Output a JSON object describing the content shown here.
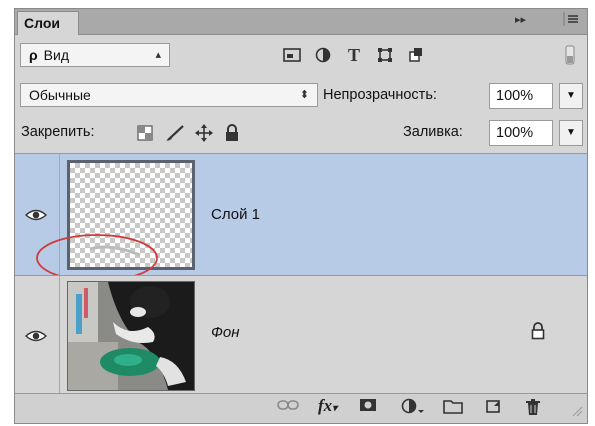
{
  "panel": {
    "tab_label": "Слои",
    "menu_glyphs": "▸▸",
    "menu_icon": "panel-menu-icon"
  },
  "filter": {
    "search_glyph": "ρ",
    "kind_label": "Вид",
    "icons": [
      "pixel-filter-icon",
      "adjustment-filter-icon",
      "type-filter-icon",
      "shape-filter-icon",
      "smart-object-filter-icon",
      "filter-toggle-icon"
    ]
  },
  "blend": {
    "mode": "Обычные",
    "opacity_label": "Непрозрачность:",
    "opacity_value": "100%"
  },
  "lock": {
    "label": "Закрепить:",
    "icons": [
      "lock-transparent-icon",
      "lock-paint-icon",
      "lock-move-icon",
      "lock-all-icon"
    ],
    "fill_label": "Заливка:",
    "fill_value": "100%"
  },
  "layers": [
    {
      "name": "Слой 1",
      "selected": true,
      "visible": true,
      "thumbnail": "transparent-checkerboard",
      "annotation": "red-circle"
    },
    {
      "name": "Фон",
      "selected": false,
      "visible": true,
      "locked": true,
      "thumbnail": "photo"
    }
  ],
  "footer": {
    "fx_label": "fx",
    "icons": [
      "link-layers-icon",
      "fx-icon",
      "mask-icon",
      "adjustment-layer-icon",
      "group-folder-icon",
      "new-layer-icon",
      "trash-icon"
    ]
  },
  "colors": {
    "panel_bg": "#d6d6d6",
    "selected_layer": "#b7cbe6",
    "annotation": "#d23a3a"
  }
}
